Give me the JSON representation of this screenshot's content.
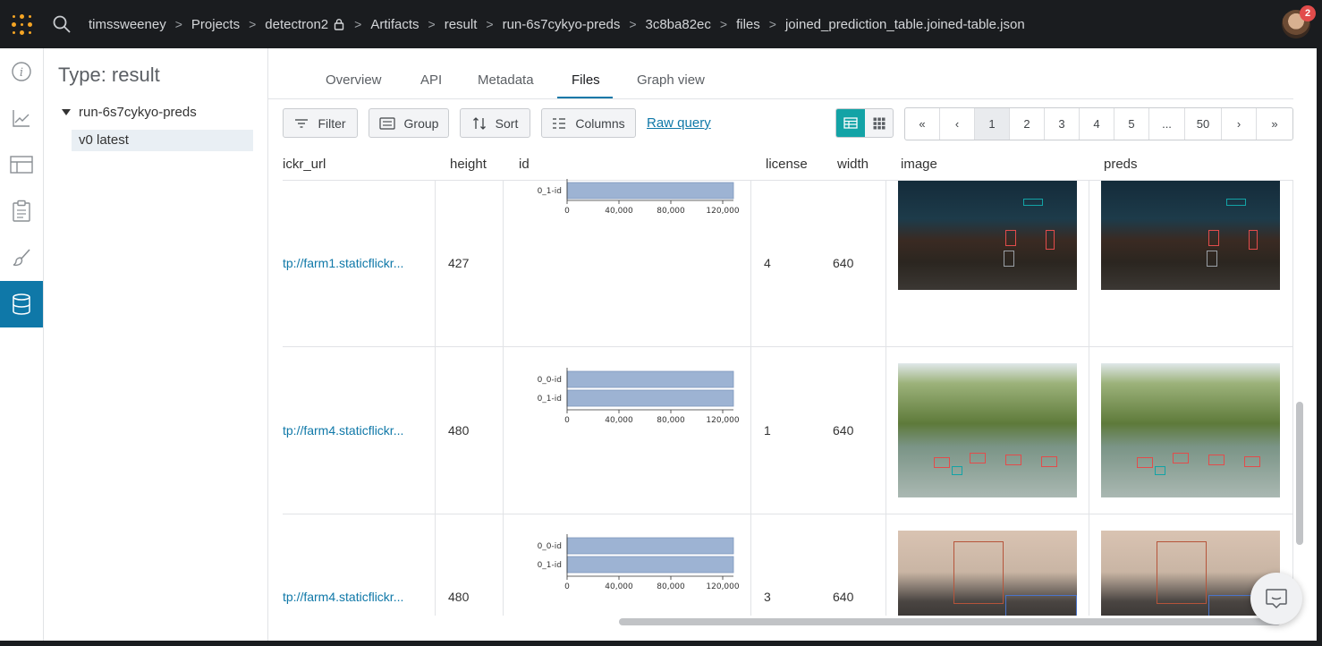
{
  "breadcrumb": [
    "timssweeney",
    "Projects",
    "detectron2",
    "Artifacts",
    "result",
    "run-6s7cykyo-preds",
    "3c8ba82ec",
    "files",
    "joined_prediction_table.joined-table.json"
  ],
  "notifications": "2",
  "sidebar": {
    "title": "Type: result",
    "run": "run-6s7cykyo-preds",
    "version": "v0 latest",
    "rail_icons": [
      "info-icon",
      "chart-line-icon",
      "table-icon",
      "clipboard-icon",
      "brush-icon",
      "database-icon"
    ]
  },
  "tabs": [
    "Overview",
    "API",
    "Metadata",
    "Files",
    "Graph view"
  ],
  "active_tab": "Files",
  "toolbar": {
    "filter": "Filter",
    "group": "Group",
    "sort": "Sort",
    "columns": "Columns",
    "raw_query": "Raw query"
  },
  "pagination": [
    "«",
    "‹",
    "1",
    "2",
    "3",
    "4",
    "5",
    "...",
    "50",
    "›",
    "»"
  ],
  "current_page": "1",
  "table": {
    "columns": [
      "ickr_url",
      "height",
      "id",
      "license",
      "width",
      "image",
      "preds"
    ],
    "rows": [
      {
        "url": "tp://farm1.staticflickr...",
        "height": "427",
        "license": "4",
        "width": "640",
        "bars": [
          "0_1-id"
        ]
      },
      {
        "url": "tp://farm4.staticflickr...",
        "height": "480",
        "license": "1",
        "width": "640",
        "bars": [
          "0_0-id",
          "0_1-id"
        ]
      },
      {
        "url": "tp://farm4.staticflickr...",
        "height": "480",
        "license": "3",
        "width": "640",
        "bars": [
          "0_0-id",
          "0_1-id"
        ]
      }
    ],
    "axis_ticks": [
      "0",
      "40,000",
      "80,000",
      "120,000"
    ]
  },
  "colors": {
    "accent": "#0f78a8",
    "toggle_active": "#13a3a6",
    "topbar": "#1a1c1f",
    "bar_fill": "#9db3d3"
  }
}
